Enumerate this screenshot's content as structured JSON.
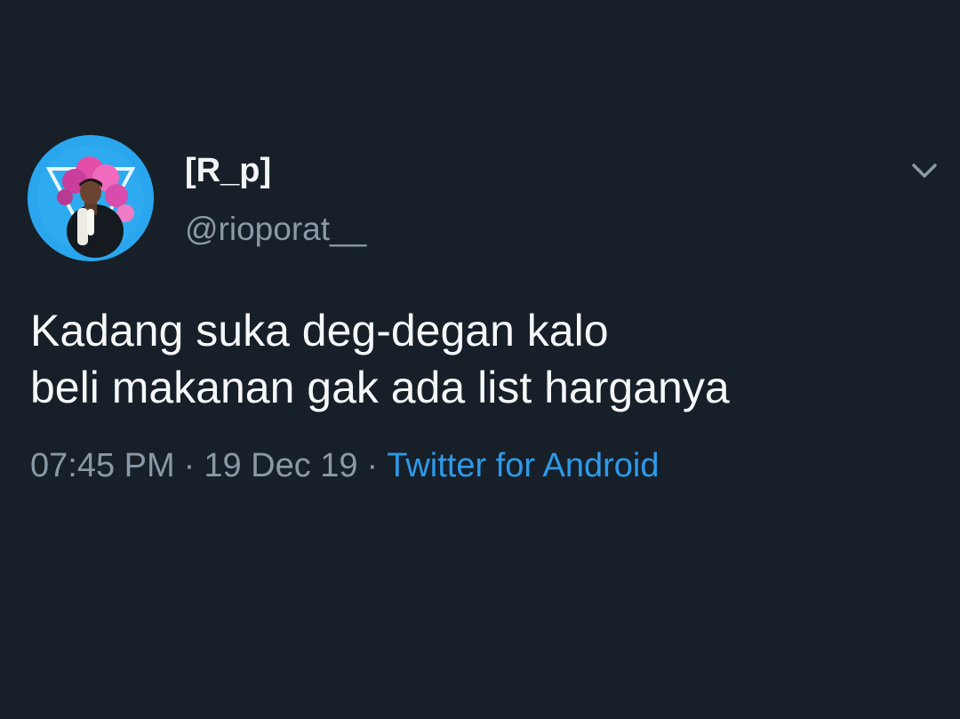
{
  "tweet": {
    "author": {
      "display_name": "[R_p]",
      "handle": "@rioporat__"
    },
    "text_lines": [
      "Kadang suka deg-degan kalo",
      "beli makanan gak ada list harganya"
    ],
    "meta": {
      "time": "07:45 PM",
      "separator": "·",
      "date": "19 Dec 19",
      "source": "Twitter for Android"
    },
    "menu_icon": "chevron-down-icon"
  },
  "colors": {
    "background": "#172029",
    "primary_text": "#f5f7f9",
    "secondary_text": "#8b98a6",
    "link": "#2e9ae8"
  }
}
